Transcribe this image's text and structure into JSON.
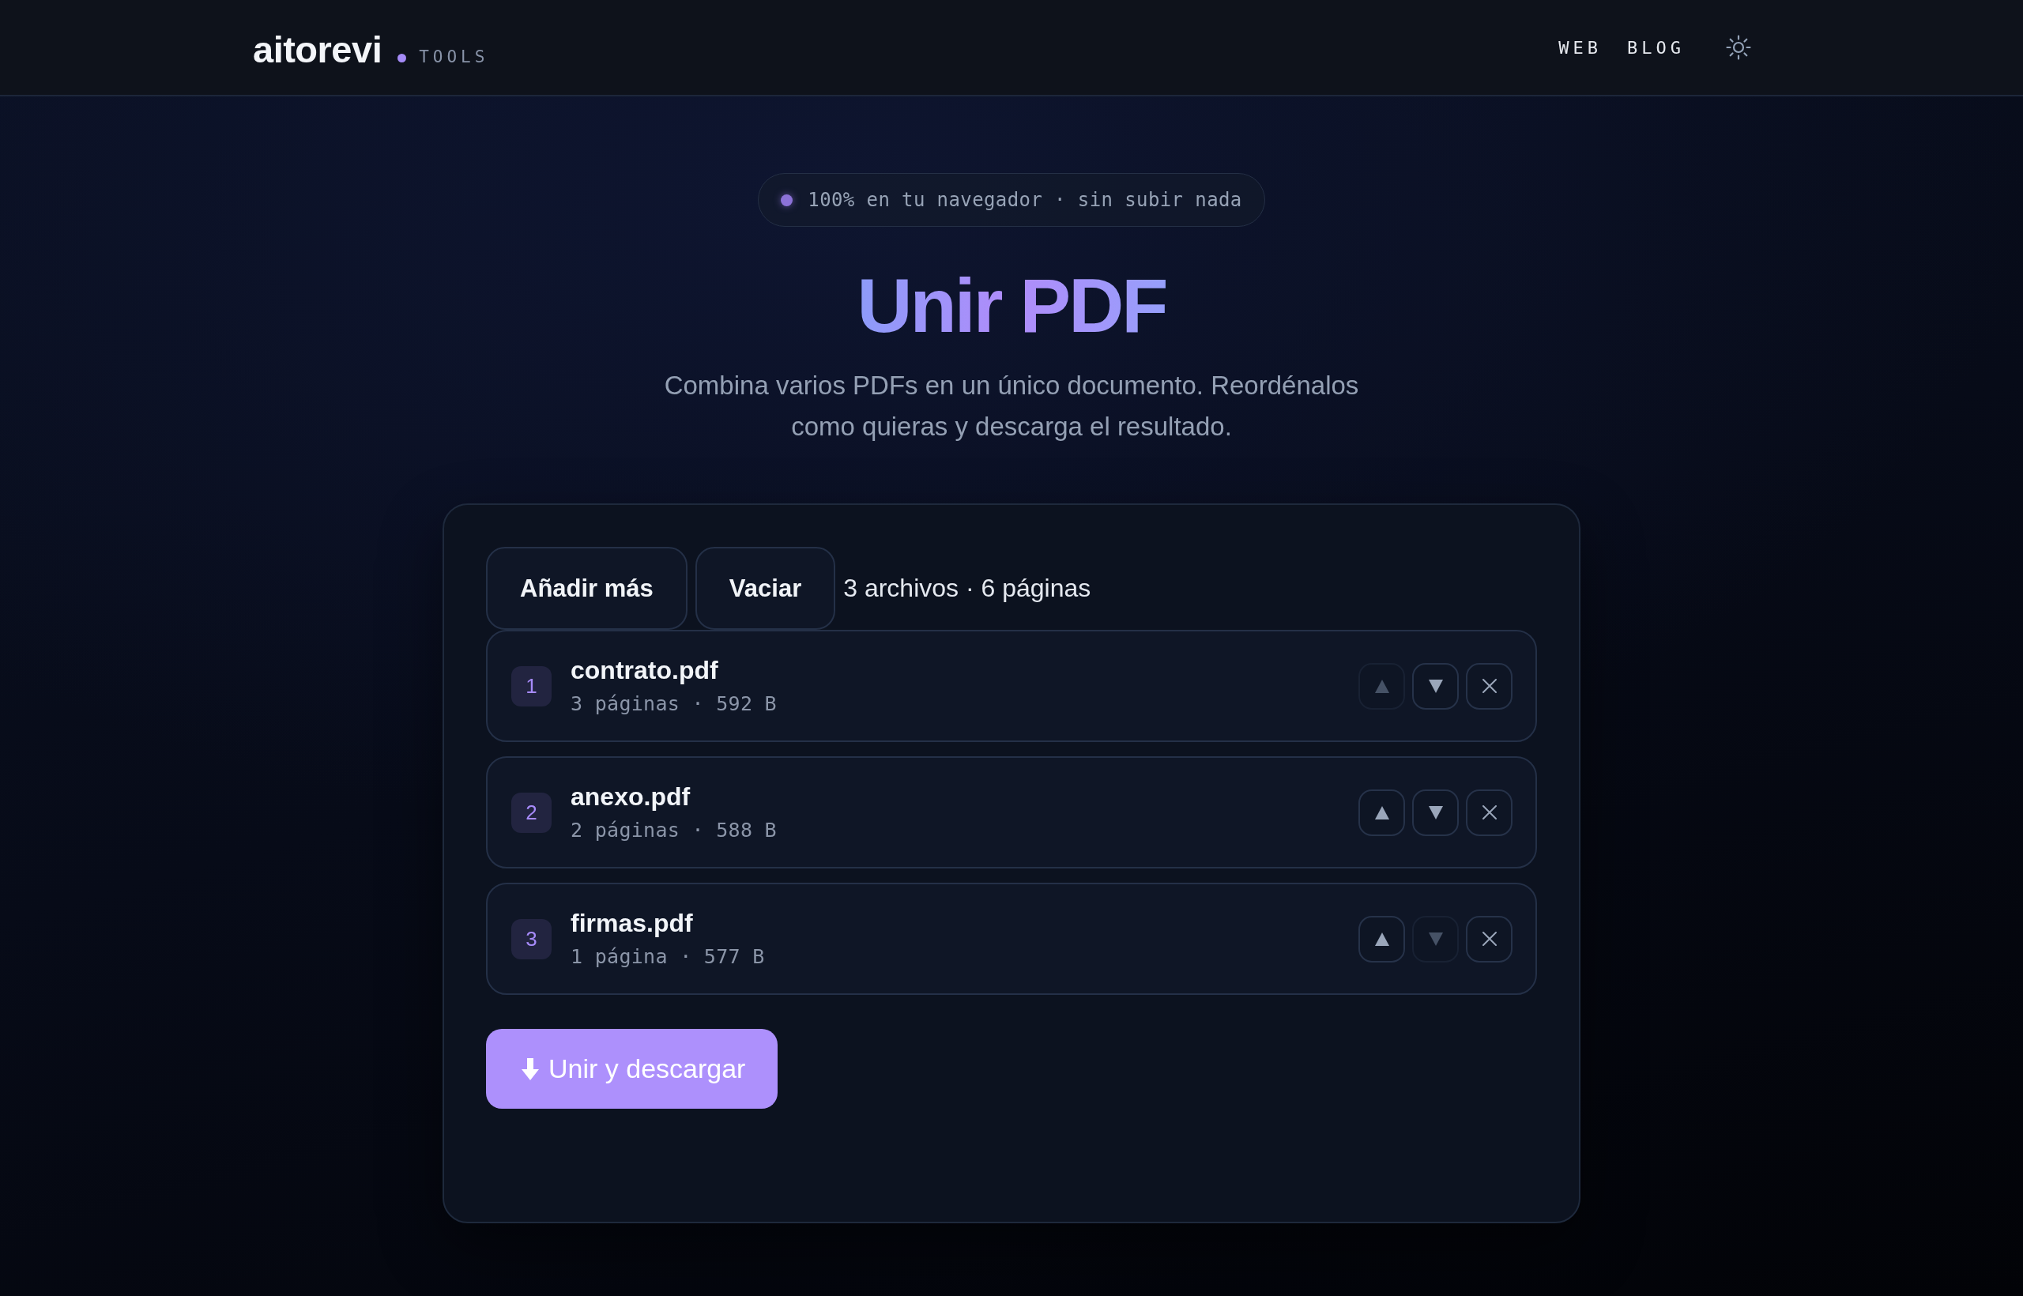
{
  "header": {
    "logo": "aitorevi",
    "logo_tag": "TOOLS",
    "nav": [
      "WEB",
      "BLOG"
    ]
  },
  "hero": {
    "badge": "100% en tu navegador · sin subir nada",
    "title": "Unir PDF",
    "subtitle": "Combina varios PDFs en un único documento. Reordénalos como quieras y descarga el resultado."
  },
  "toolbar": {
    "buttons": [
      "Añadir más",
      "Vaciar"
    ],
    "summary": "3 archivos · 6 páginas"
  },
  "files": [
    {
      "index": "1",
      "name": "contrato.pdf",
      "meta": "3 páginas · 592 B",
      "up_disabled": true,
      "down_disabled": false
    },
    {
      "index": "2",
      "name": "anexo.pdf",
      "meta": "2 páginas · 588 B",
      "up_disabled": false,
      "down_disabled": false
    },
    {
      "index": "3",
      "name": "firmas.pdf",
      "meta": "1 página · 577 B",
      "up_disabled": false,
      "down_disabled": true
    }
  ],
  "merge_button": "Unir y descargar"
}
